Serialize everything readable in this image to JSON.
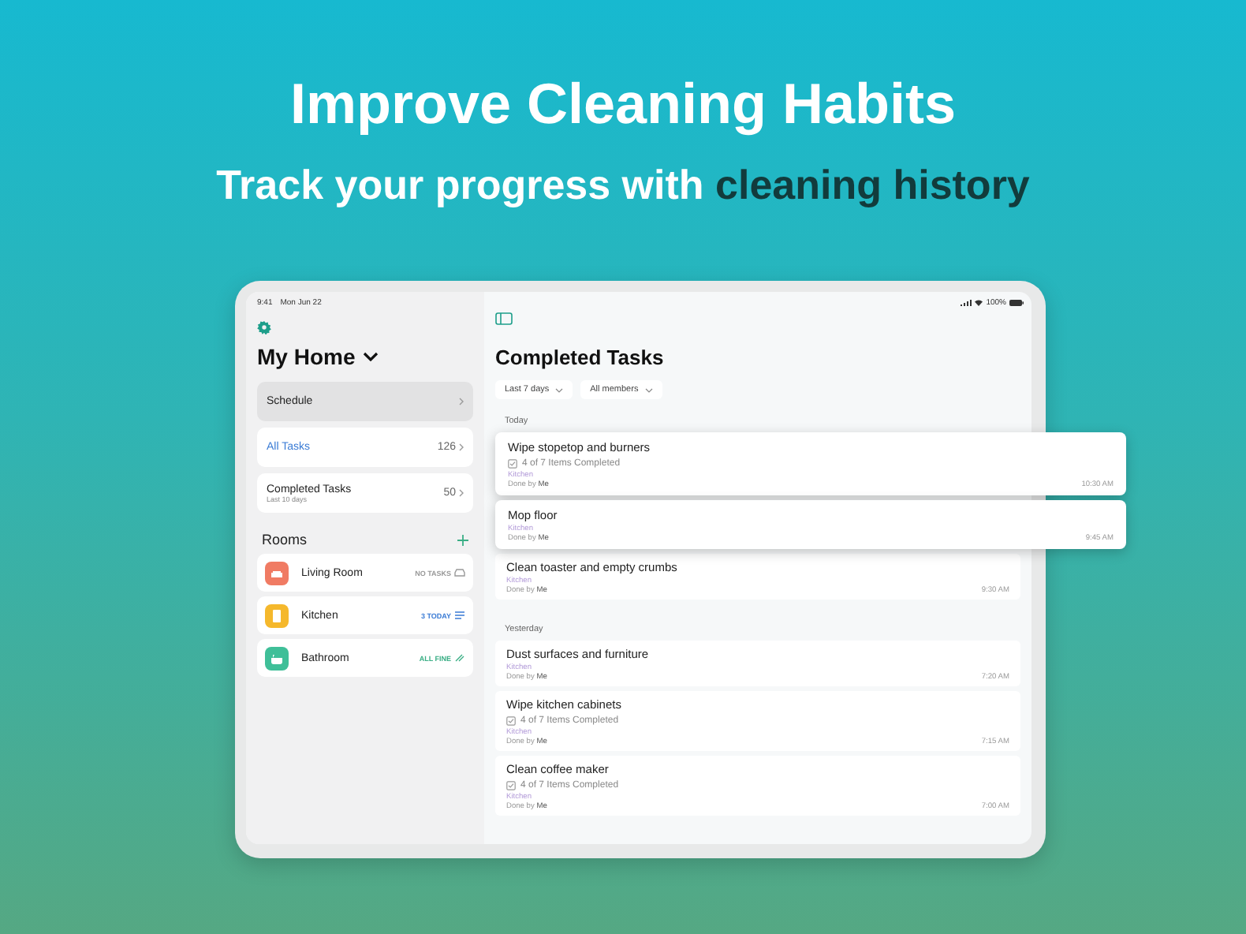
{
  "headline": "Improve Cleaning Habits",
  "subheadline": "Track your progress with **cleaning history**",
  "status_bar": {
    "time": "9:41",
    "date": "Mon Jun 22",
    "battery": "100%"
  },
  "sidebar": {
    "home_title": "My Home",
    "items": [
      {
        "label": "Schedule",
        "selected": true,
        "highlighted": false
      },
      {
        "label": "All Tasks",
        "count": "126",
        "selected": false,
        "highlighted": true
      },
      {
        "label": "Completed Tasks",
        "count": "50",
        "subtitle": "Last 10 days",
        "selected": false,
        "highlighted": false
      }
    ],
    "rooms_title": "Rooms",
    "rooms": [
      {
        "name": "Living Room",
        "color": "#f07b63",
        "status": "NO TASKS",
        "kind": "none"
      },
      {
        "name": "Kitchen",
        "color": "#f5b82c",
        "status": "3 TODAY",
        "kind": "today"
      },
      {
        "name": "Bathroom",
        "color": "#3fbf98",
        "status": "ALL FINE",
        "kind": "fine"
      }
    ]
  },
  "main": {
    "title": "Completed Tasks",
    "filters": [
      "Last 7 days",
      "All members"
    ],
    "sections": [
      {
        "label": "Today",
        "tasks": [
          {
            "title": "Wipe stopetop and burners",
            "checklist": {
              "text": "4 of 7 Items Completed",
              "checked": true
            },
            "room": "Kitchen",
            "done_by": "Done by **Me**",
            "time": "10:30 AM",
            "kind": "raised"
          },
          {
            "title": "Mop floor",
            "room": "Kitchen",
            "done_by": "Done by **Me**",
            "time": "9:45 AM",
            "kind": "raised"
          },
          {
            "title": "Clean toaster and empty crumbs",
            "room": "Kitchen",
            "done_by": "Done by **Me**",
            "time": "9:30 AM",
            "kind": "plain"
          }
        ]
      },
      {
        "label": "Yesterday",
        "tasks": [
          {
            "title": "Dust surfaces and furniture",
            "room": "Kitchen",
            "done_by": "Done by **Me**",
            "time": "7:20 AM",
            "kind": "plain"
          },
          {
            "title": "Wipe kitchen cabinets",
            "checklist": {
              "text": "4 of 7 Items Completed",
              "checked": true
            },
            "room": "Kitchen",
            "done_by": "Done by **Me**",
            "time": "7:15 AM",
            "kind": "plain"
          },
          {
            "title": "Clean coffee maker",
            "checklist": {
              "text": "4 of 7 Items Completed",
              "checked": true
            },
            "room": "Kitchen",
            "done_by": "Done by **Me**",
            "time": "7:00 AM",
            "kind": "plain"
          }
        ]
      }
    ]
  }
}
